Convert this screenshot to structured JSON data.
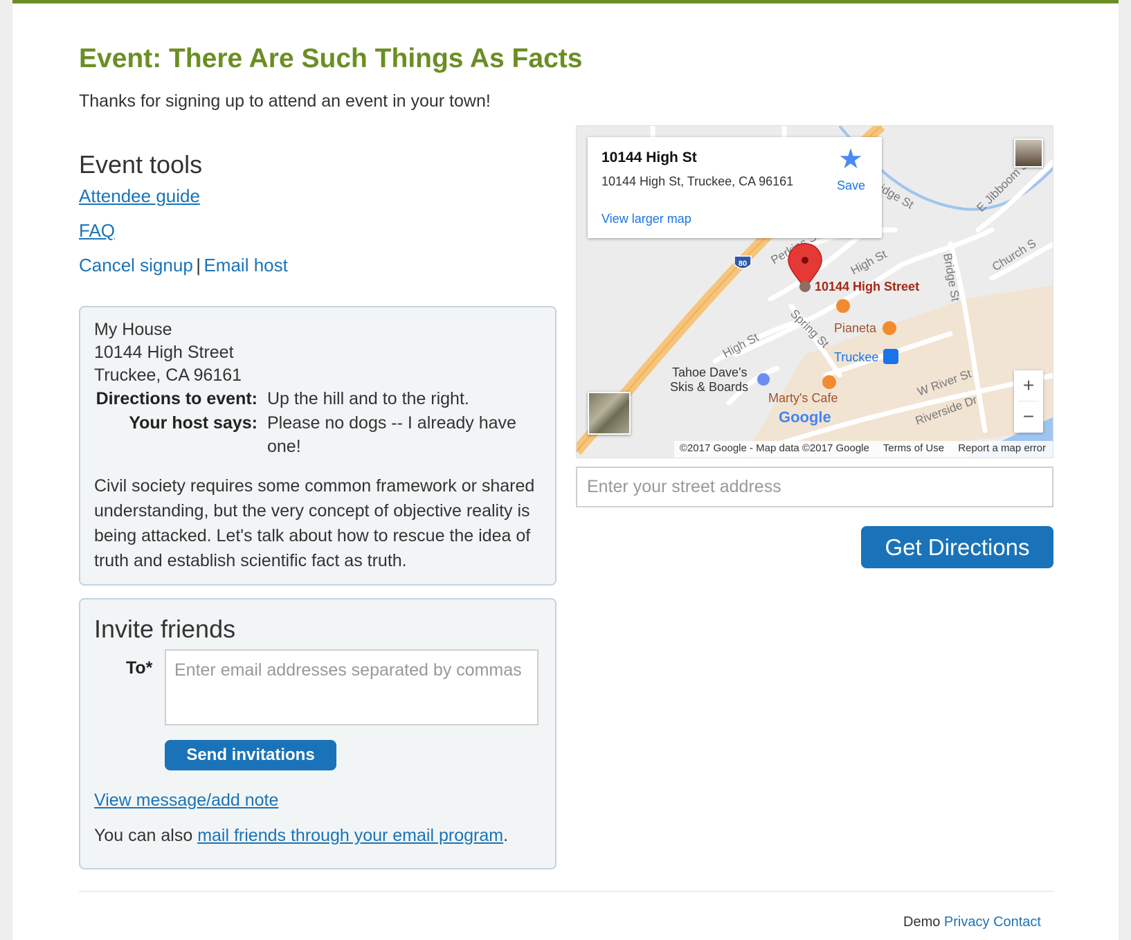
{
  "header": {
    "title": "Event: There Are Such Things As Facts",
    "subtitle": "Thanks for signing up to attend an event in your town!"
  },
  "event_tools": {
    "heading": "Event tools",
    "attendee_guide": "Attendee guide",
    "faq": "FAQ",
    "cancel_signup": "Cancel signup",
    "separator": "|",
    "email_host": "Email host"
  },
  "event": {
    "venue_name": "My House",
    "street": "10144 High Street",
    "city_line": "Truckee, CA 96161",
    "directions_label": "Directions to event:",
    "directions_value": "Up the hill and to the right.",
    "host_label": "Your host says:",
    "host_value": "Please no dogs -- I already have one!",
    "description": "Civil society requires some common framework or shared understanding, but the very concept of objective reality is being attacked. Let's talk about how to rescue the idea of truth and establish scientific fact as truth."
  },
  "invite": {
    "heading": "Invite friends",
    "to_label": "To*",
    "to_placeholder": "Enter email addresses separated by commas",
    "send_button": "Send invitations",
    "view_message_link": "View message/add note",
    "mail_prefix": "You can also ",
    "mail_link": "mail friends through your email program",
    "mail_suffix": "."
  },
  "map": {
    "info_title": "10144 High St",
    "info_address": "10144 High St, Truckee, CA 96161",
    "info_save": "Save",
    "info_view_larger": "View larger map",
    "marker_label": "10144 High Street",
    "zoom_in": "+",
    "zoom_out": "−",
    "attribution": "©2017 Google - Map data ©2017 Google",
    "terms": "Terms of Use",
    "report": "Report a map error",
    "labels": {
      "high_st_1": "High St",
      "high_st_2": "High St",
      "spring_st": "Spring St",
      "bridge_st_1": "Bridge St",
      "bridge_st_2": "Bridge St",
      "e_jibboom": "E Jibboom St",
      "church": "Church S",
      "pianeta": "Pianeta",
      "truckee": "Truckee",
      "tahoe_daves_1": "Tahoe Dave's",
      "tahoe_daves_2": "Skis & Boards",
      "martys": "Marty's Cafe",
      "w_river": "W River St",
      "riverside": "Riverside Dr",
      "i80": "80",
      "google": "Google",
      "perkins": "Perkins St"
    },
    "colors": {
      "freeway": "#f6c57b",
      "river": "#9ec5f0",
      "marker": "#e53935",
      "label_red": "#a52714",
      "poi_orange": "#f28b30",
      "transit_blue": "#1a73e8"
    }
  },
  "directions": {
    "address_placeholder": "Enter your street address",
    "button": "Get Directions"
  },
  "footer": {
    "demo": "Demo",
    "privacy": "Privacy",
    "contact": "Contact"
  }
}
